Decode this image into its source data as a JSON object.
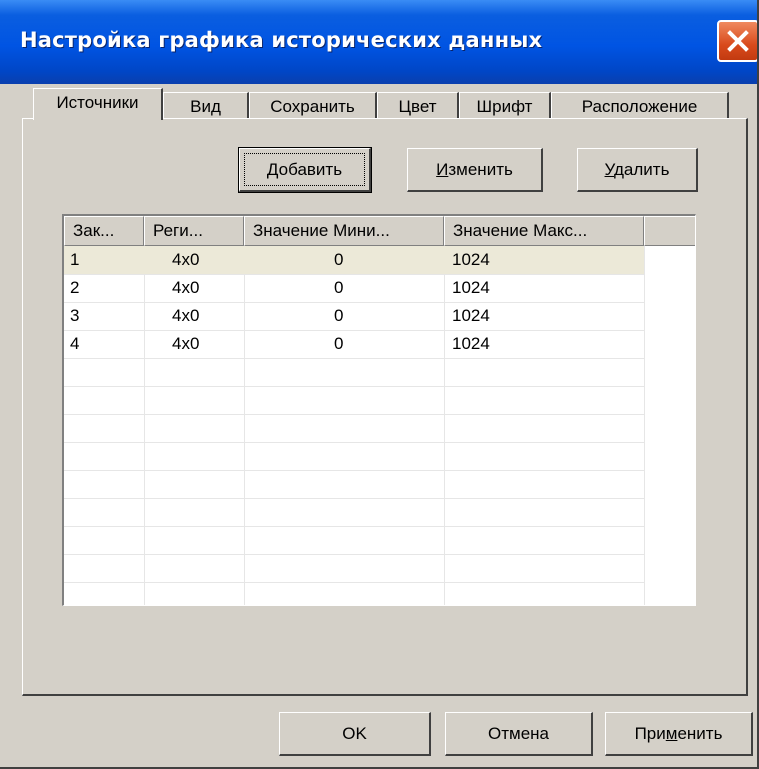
{
  "window": {
    "title": "Настройка графика исторических данных"
  },
  "tabs": [
    {
      "label": "Источники",
      "active": true
    },
    {
      "label": "Вид"
    },
    {
      "label": "Сохранить"
    },
    {
      "label": "Цвет"
    },
    {
      "label": "Шрифт"
    },
    {
      "label": "Расположение"
    }
  ],
  "actions": {
    "add": {
      "prefix": "",
      "accel": "Д",
      "rest": "обавить"
    },
    "edit": {
      "prefix": "",
      "accel": "И",
      "rest": "зменить"
    },
    "delete": {
      "prefix": "",
      "accel": "У",
      "rest": "далить"
    }
  },
  "table": {
    "columns": [
      "Зак...",
      "Реги...",
      "Значение Мини...",
      "Значение Макс...",
      ""
    ],
    "rows": [
      [
        "1",
        "4x0",
        "0",
        "1024"
      ],
      [
        "2",
        "4x0",
        "0",
        "1024"
      ],
      [
        "3",
        "4x0",
        "0",
        "1024"
      ],
      [
        "4",
        "4x0",
        "0",
        "1024"
      ]
    ]
  },
  "footer": {
    "ok": "OK",
    "cancel": "Отмена",
    "apply": {
      "prefix": "При",
      "accel": "м",
      "rest": "енить"
    }
  },
  "colors": {
    "titlebar": "#0054e3",
    "face": "#d4d0c8",
    "close": "#d94a1c"
  }
}
